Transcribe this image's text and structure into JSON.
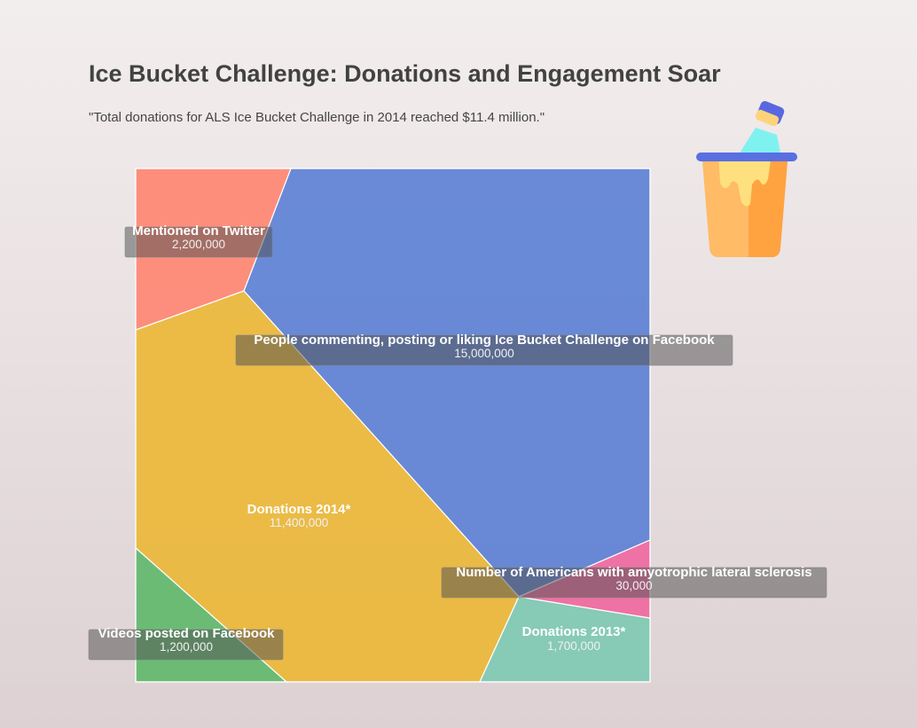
{
  "title": "Ice Bucket Challenge: Donations and Engagement Soar",
  "subtitle": "\"Total donations for ALS Ice Bucket Challenge in 2014 reached $11.4 million.\"",
  "icon": "ice-bucket-icon",
  "chart_data": {
    "type": "voronoi-treemap",
    "title": "Ice Bucket Challenge: Donations and Engagement Soar",
    "subtitle": "\"Total donations for ALS Ice Bucket Challenge in 2014 reached $11.4 million.\"",
    "items": [
      {
        "name": "People commenting, posting or liking Ice Bucket Challenge on Facebook",
        "value": 15000000,
        "value_label": "15,000,000",
        "color": "#5b7fd5",
        "boxed": true
      },
      {
        "name": "Donations 2014*",
        "value": 11400000,
        "value_label": "11,400,000",
        "color": "#ebb735",
        "boxed": false
      },
      {
        "name": "Mentioned on Twitter",
        "value": 2200000,
        "value_label": "2,200,000",
        "color": "#ff8470",
        "boxed": true
      },
      {
        "name": "Donations 2013*",
        "value": 1700000,
        "value_label": "1,700,000",
        "color": "#7dc9b3",
        "boxed": false
      },
      {
        "name": "Videos posted on Facebook",
        "value": 1200000,
        "value_label": "1,200,000",
        "color": "#5eb86a",
        "boxed": true
      },
      {
        "name": "Number of Americans with amyotrophic lateral sclerosis",
        "value": 30000,
        "value_label": "30,000",
        "color": "#f0679f",
        "boxed": true
      }
    ]
  }
}
